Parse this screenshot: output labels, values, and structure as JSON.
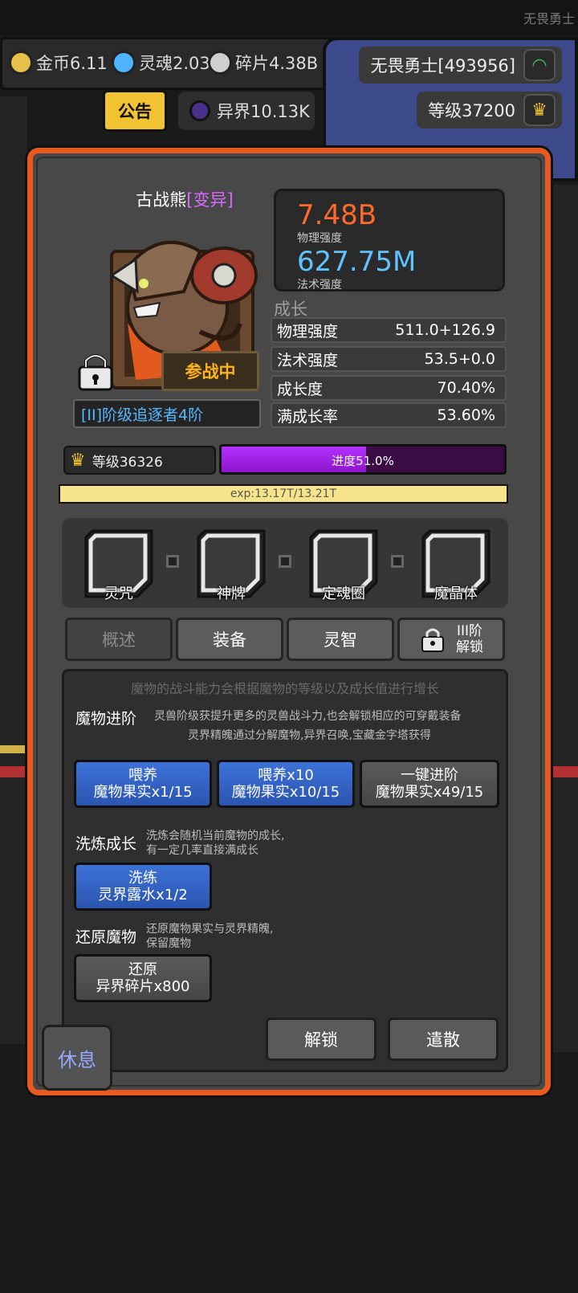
{
  "window": {
    "title": "无畏勇士"
  },
  "resources": [
    {
      "label": "金币6.11",
      "icon": "coin-icon",
      "color": "#e8c14a"
    },
    {
      "label": "灵魂2.03",
      "icon": "soul-icon",
      "color": "#4fb4ff"
    },
    {
      "label": "碎片4.38B",
      "icon": "shard-icon",
      "color": "#cfcfcf"
    }
  ],
  "player": {
    "name": "无畏勇士[493956]",
    "level": "等级37200"
  },
  "notice_label": "公告",
  "other_world": "异界10.13K",
  "monster": {
    "name": "古战熊",
    "variant": "[变异]",
    "status": "参战中",
    "rank": "[II]阶级追逐者4阶"
  },
  "power": {
    "physical_value": "7.48B",
    "physical_label": "物理强度",
    "magic_value": "627.75M",
    "magic_label": "法术强度"
  },
  "growth": {
    "title": "成长",
    "rows": [
      {
        "label": "物理强度",
        "value": "511.0+126.9"
      },
      {
        "label": "法术强度",
        "value": "53.5+0.0"
      },
      {
        "label": "成长度",
        "value": "70.40%"
      },
      {
        "label": "满成长率",
        "value": "53.60%"
      }
    ]
  },
  "level": {
    "label": "等级36326",
    "progress_text": "进度51.0%",
    "progress_fraction": 0.51,
    "exp_text": "exp:13.17T/13.21T",
    "exp_fraction": 0.997
  },
  "equip_slots": [
    {
      "label": "灵咒"
    },
    {
      "label": "神牌"
    },
    {
      "label": "定魂圈"
    },
    {
      "label": "魔晶体"
    }
  ],
  "tabs": [
    {
      "label": "概述"
    },
    {
      "label": "装备"
    },
    {
      "label": "灵智"
    },
    {
      "label": "III阶",
      "label2": "解锁"
    }
  ],
  "content": {
    "intro": "魔物的战斗能力会根据魔物的等级以及成长值进行增长",
    "advance": {
      "title": "魔物进阶",
      "desc1": "灵兽阶级获提升更多的灵兽战斗力,也会解锁相应的可穿戴装备",
      "desc2": "灵界精魄通过分解魔物,异界召唤,宝藏金字塔获得",
      "buttons": [
        {
          "line1": "喂养",
          "line2": "魔物果实x1/15"
        },
        {
          "line1": "喂养x10",
          "line2": "魔物果实x10/15"
        },
        {
          "line1": "一键进阶",
          "line2": "魔物果实x49/15"
        }
      ]
    },
    "refine": {
      "title": "洗炼成长",
      "desc1": "洗炼会随机当前魔物的成长,",
      "desc2": "有一定几率直接满成长",
      "button": {
        "line1": "洗练",
        "line2": "灵界露水x1/2"
      }
    },
    "restore": {
      "title": "还原魔物",
      "desc1": "还原魔物果实与灵界精魄,",
      "desc2": "保留魔物",
      "button": {
        "line1": "还原",
        "line2": "异界碎片x800"
      }
    }
  },
  "bottom_buttons": {
    "unlock": "解锁",
    "dismiss": "遣散"
  },
  "rest_label": "休息"
}
